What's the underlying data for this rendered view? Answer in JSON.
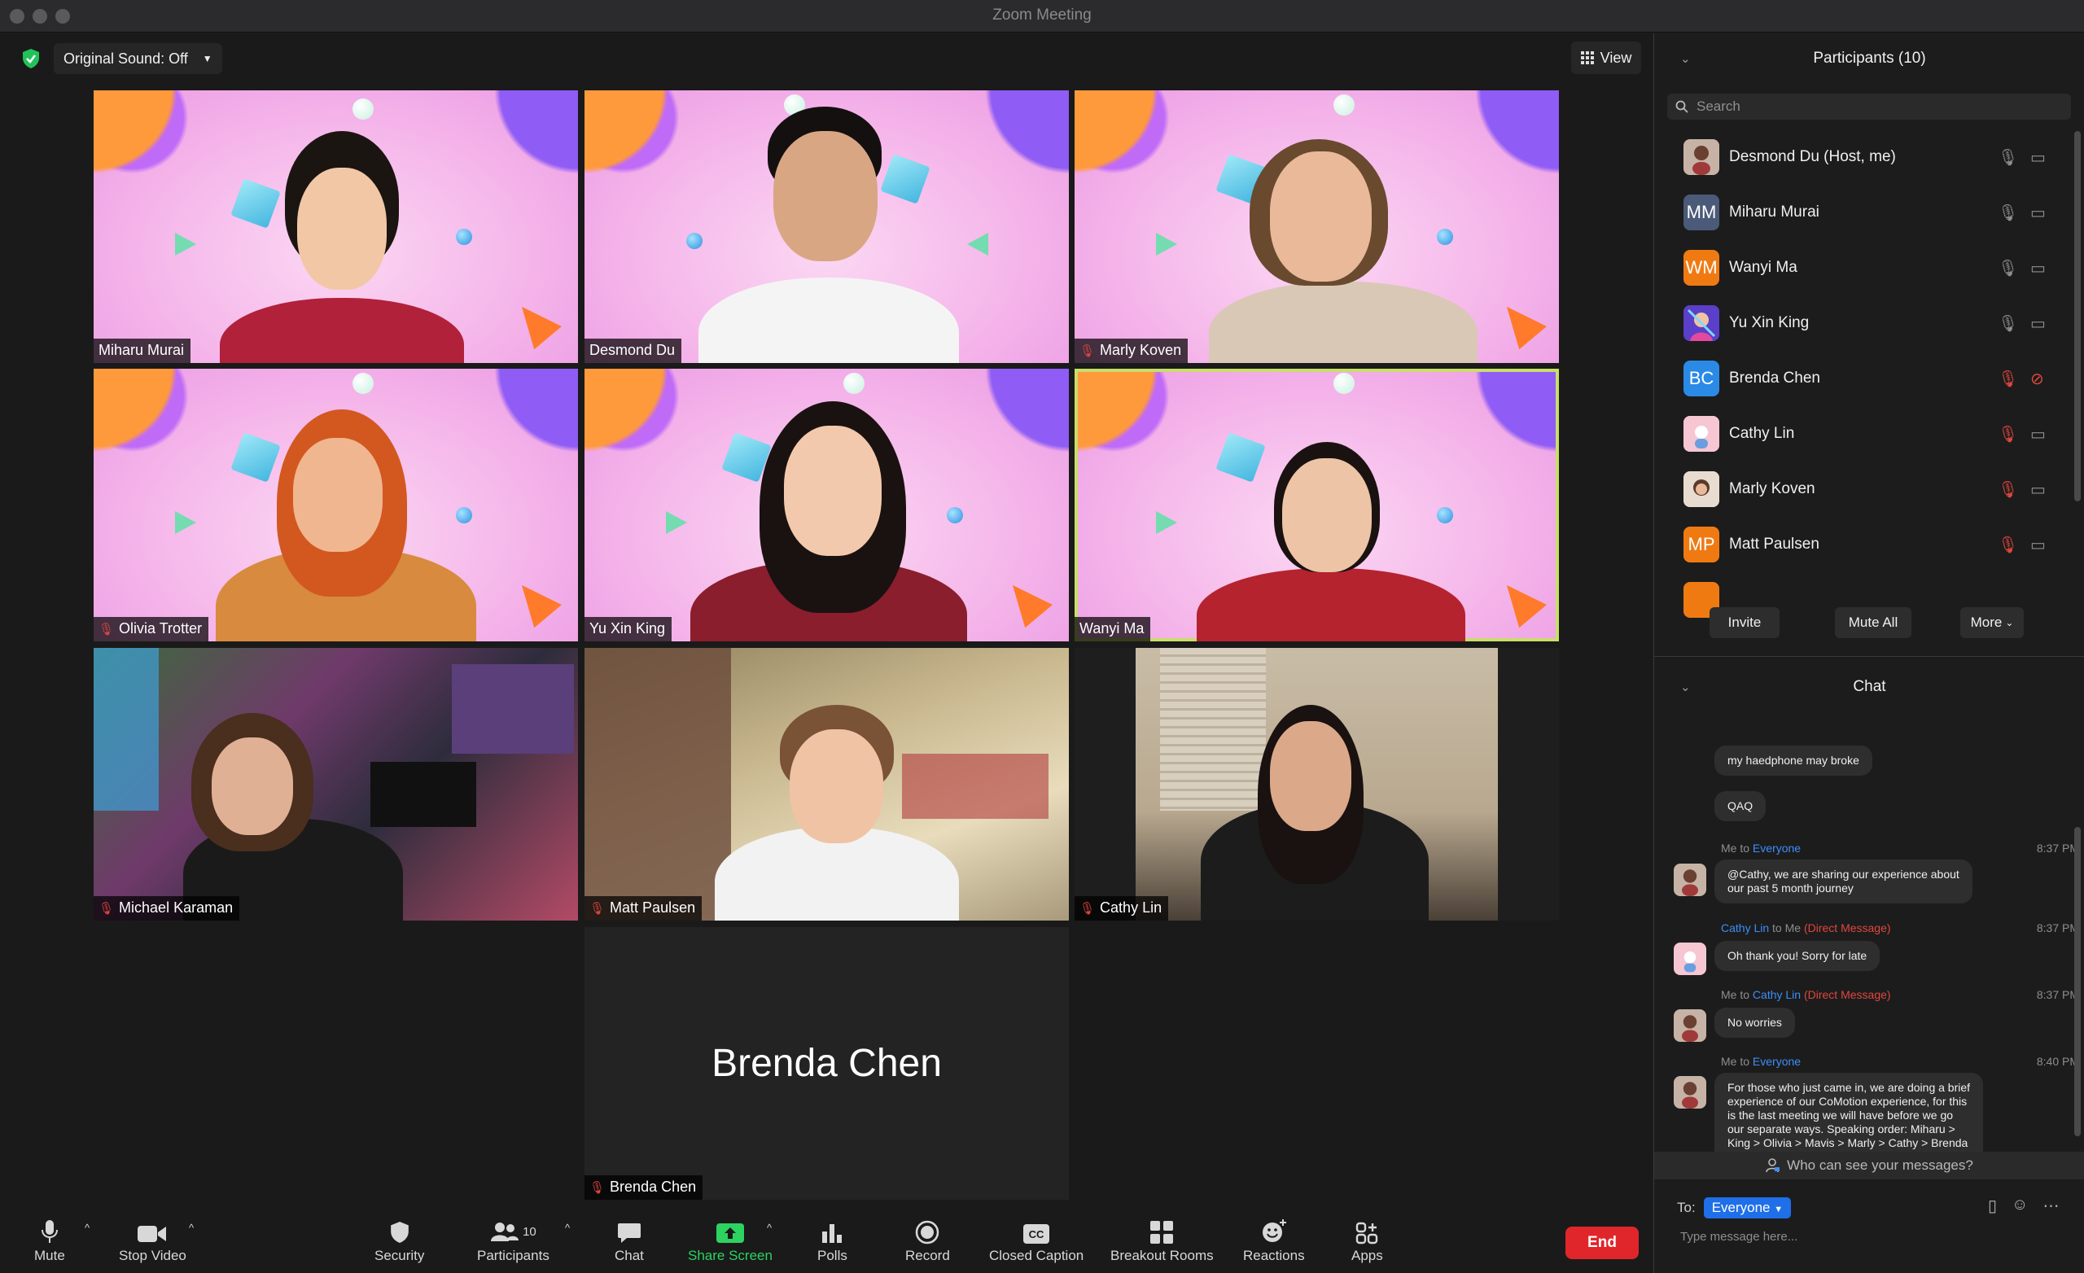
{
  "window": {
    "title": "Zoom Meeting"
  },
  "top": {
    "original_sound": "Original Sound: Off",
    "view_label": "View"
  },
  "tiles": [
    {
      "name": "Miharu Murai",
      "muted": false
    },
    {
      "name": "Desmond Du",
      "muted": false
    },
    {
      "name": "Marly Koven",
      "muted": true
    },
    {
      "name": "Olivia Trotter",
      "muted": true
    },
    {
      "name": "Yu Xin King",
      "muted": false
    },
    {
      "name": "Wanyi Ma",
      "muted": false
    },
    {
      "name": "Michael Karaman",
      "muted": true
    },
    {
      "name": "Matt Paulsen",
      "muted": true
    },
    {
      "name": "Cathy Lin",
      "muted": true
    },
    {
      "name": "Brenda Chen",
      "muted": true,
      "center_name": "Brenda Chen"
    }
  ],
  "toolbar": {
    "mute": "Mute",
    "stop_video": "Stop Video",
    "security": "Security",
    "participants": "Participants",
    "participants_count": "10",
    "chat": "Chat",
    "share_screen": "Share Screen",
    "polls": "Polls",
    "record": "Record",
    "closed_caption": "Closed Caption",
    "breakout_rooms": "Breakout Rooms",
    "reactions": "Reactions",
    "apps": "Apps",
    "end": "End"
  },
  "participants_panel": {
    "title": "Participants (10)",
    "search_placeholder": "Search",
    "items": [
      {
        "name": "Desmond Du (Host, me)",
        "initials": "",
        "color": "#7a5a4a",
        "mic_off": false,
        "cam_off": false
      },
      {
        "name": "Miharu Murai",
        "initials": "MM",
        "color": "#4a5a78",
        "mic_off": false,
        "cam_off": false
      },
      {
        "name": "Wanyi Ma",
        "initials": "WM",
        "color": "#f07a12",
        "mic_off": false,
        "cam_off": false
      },
      {
        "name": "Yu Xin King",
        "initials": "",
        "color": "#6b4ad8",
        "mic_off": false,
        "cam_off": false
      },
      {
        "name": "Brenda Chen",
        "initials": "BC",
        "color": "#2a8ae6",
        "mic_off": true,
        "cam_off": true
      },
      {
        "name": "Cathy Lin",
        "initials": "",
        "color": "#f2a6b8",
        "mic_off": true,
        "cam_off": false
      },
      {
        "name": "Marly Koven",
        "initials": "",
        "color": "#d8c6b8",
        "mic_off": true,
        "cam_off": false
      },
      {
        "name": "Matt Paulsen",
        "initials": "MP",
        "color": "#f07a12",
        "mic_off": true,
        "cam_off": false
      }
    ],
    "invite": "Invite",
    "mute_all": "Mute All",
    "more": "More"
  },
  "chat_panel": {
    "title": "Chat",
    "messages": [
      {
        "text": "my haedphone may broke"
      },
      {
        "text": "QAQ"
      },
      {
        "from": "Me",
        "to_word": "to",
        "to": "Everyone",
        "time": "8:37 PM",
        "text": "@Cathy, we are sharing our experience about\nour past 5 month journey"
      },
      {
        "from": "Cathy Lin",
        "to_word": "to Me",
        "dm": "(Direct Message)",
        "time": "8:37 PM",
        "text": "Oh thank you! Sorry for late"
      },
      {
        "from": "Me",
        "to_word": "to",
        "to": "Cathy Lin",
        "dm": "(Direct Message)",
        "time": "8:37 PM",
        "text": "No worries"
      },
      {
        "from": "Me",
        "to_word": "to",
        "to": "Everyone",
        "time": "8:40 PM",
        "text": "For those who just came in, we are doing a brief\nexperience of our CoMotion experience, for this\nis the last meeting we will have before we go\nour separate ways. Speaking order: Miharu >\nKing > Olivia > Mavis > Marly > Cathy > Brenda\n> Matt > Michael > Des"
      }
    ],
    "who_can_see": "Who can see your messages?",
    "to_label": "To:",
    "to_value": "Everyone",
    "placeholder": "Type message here..."
  }
}
